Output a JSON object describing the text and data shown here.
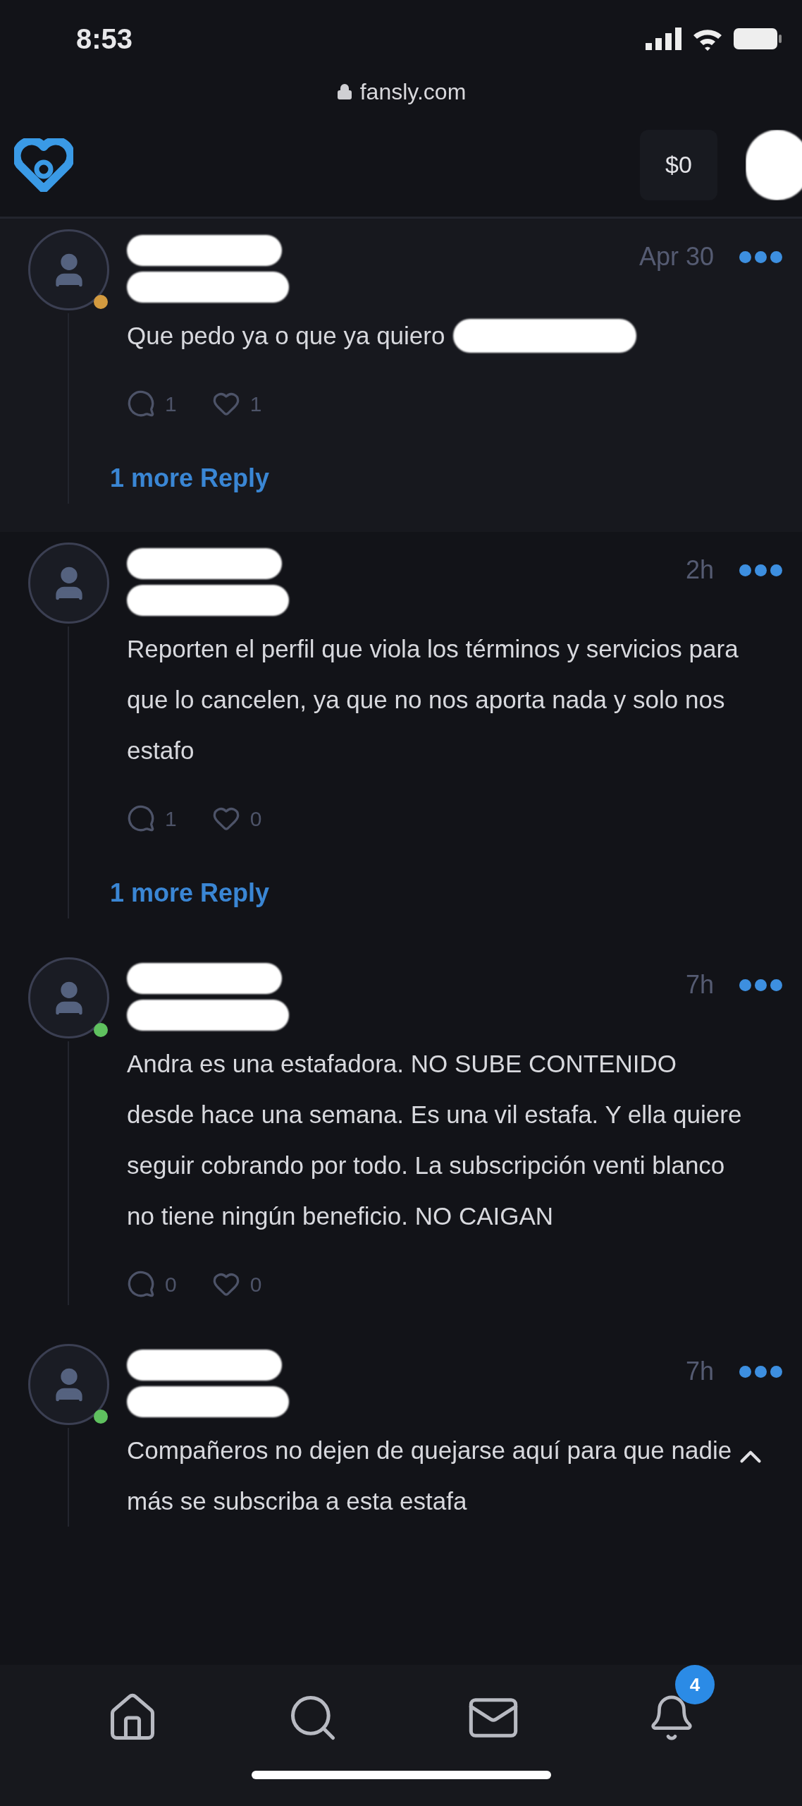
{
  "status_bar": {
    "time": "8:53"
  },
  "browser": {
    "url": "fansly.com"
  },
  "header": {
    "balance": "$0"
  },
  "comments": [
    {
      "highlighted": true,
      "color": "#d39a3f",
      "time": "Apr 30",
      "text": "Que pedo ya o que ya quiero",
      "text_redacted": true,
      "replies": "1",
      "likes": "1",
      "more_replies": "1 more Reply"
    },
    {
      "highlighted": false,
      "time": "2h",
      "text": "Reporten el perfil que viola los términos y servicios para que lo cancelen, ya que no nos aporta nada y solo nos estafo",
      "text_redacted": false,
      "replies": "1",
      "likes": "0",
      "more_replies": "1 more Reply"
    },
    {
      "highlighted": false,
      "color": "#5fc15f",
      "time": "7h",
      "text": "Andra es una estafadora. NO SUBE CONTENIDO desde hace una semana. Es una vil estafa. Y ella quiere seguir cobrando por todo. La subscripción venti blanco no tiene ningún beneficio. NO CAIGAN",
      "text_redacted": false,
      "replies": "0",
      "likes": "0"
    },
    {
      "highlighted": false,
      "color": "#5fc15f",
      "time": "7h",
      "text": "Compañeros no dejen de quejarse aquí para que nadie más se subscriba a esta estafa",
      "text_redacted": false
    }
  ],
  "bottom_nav": {
    "notification_badge": "4"
  }
}
